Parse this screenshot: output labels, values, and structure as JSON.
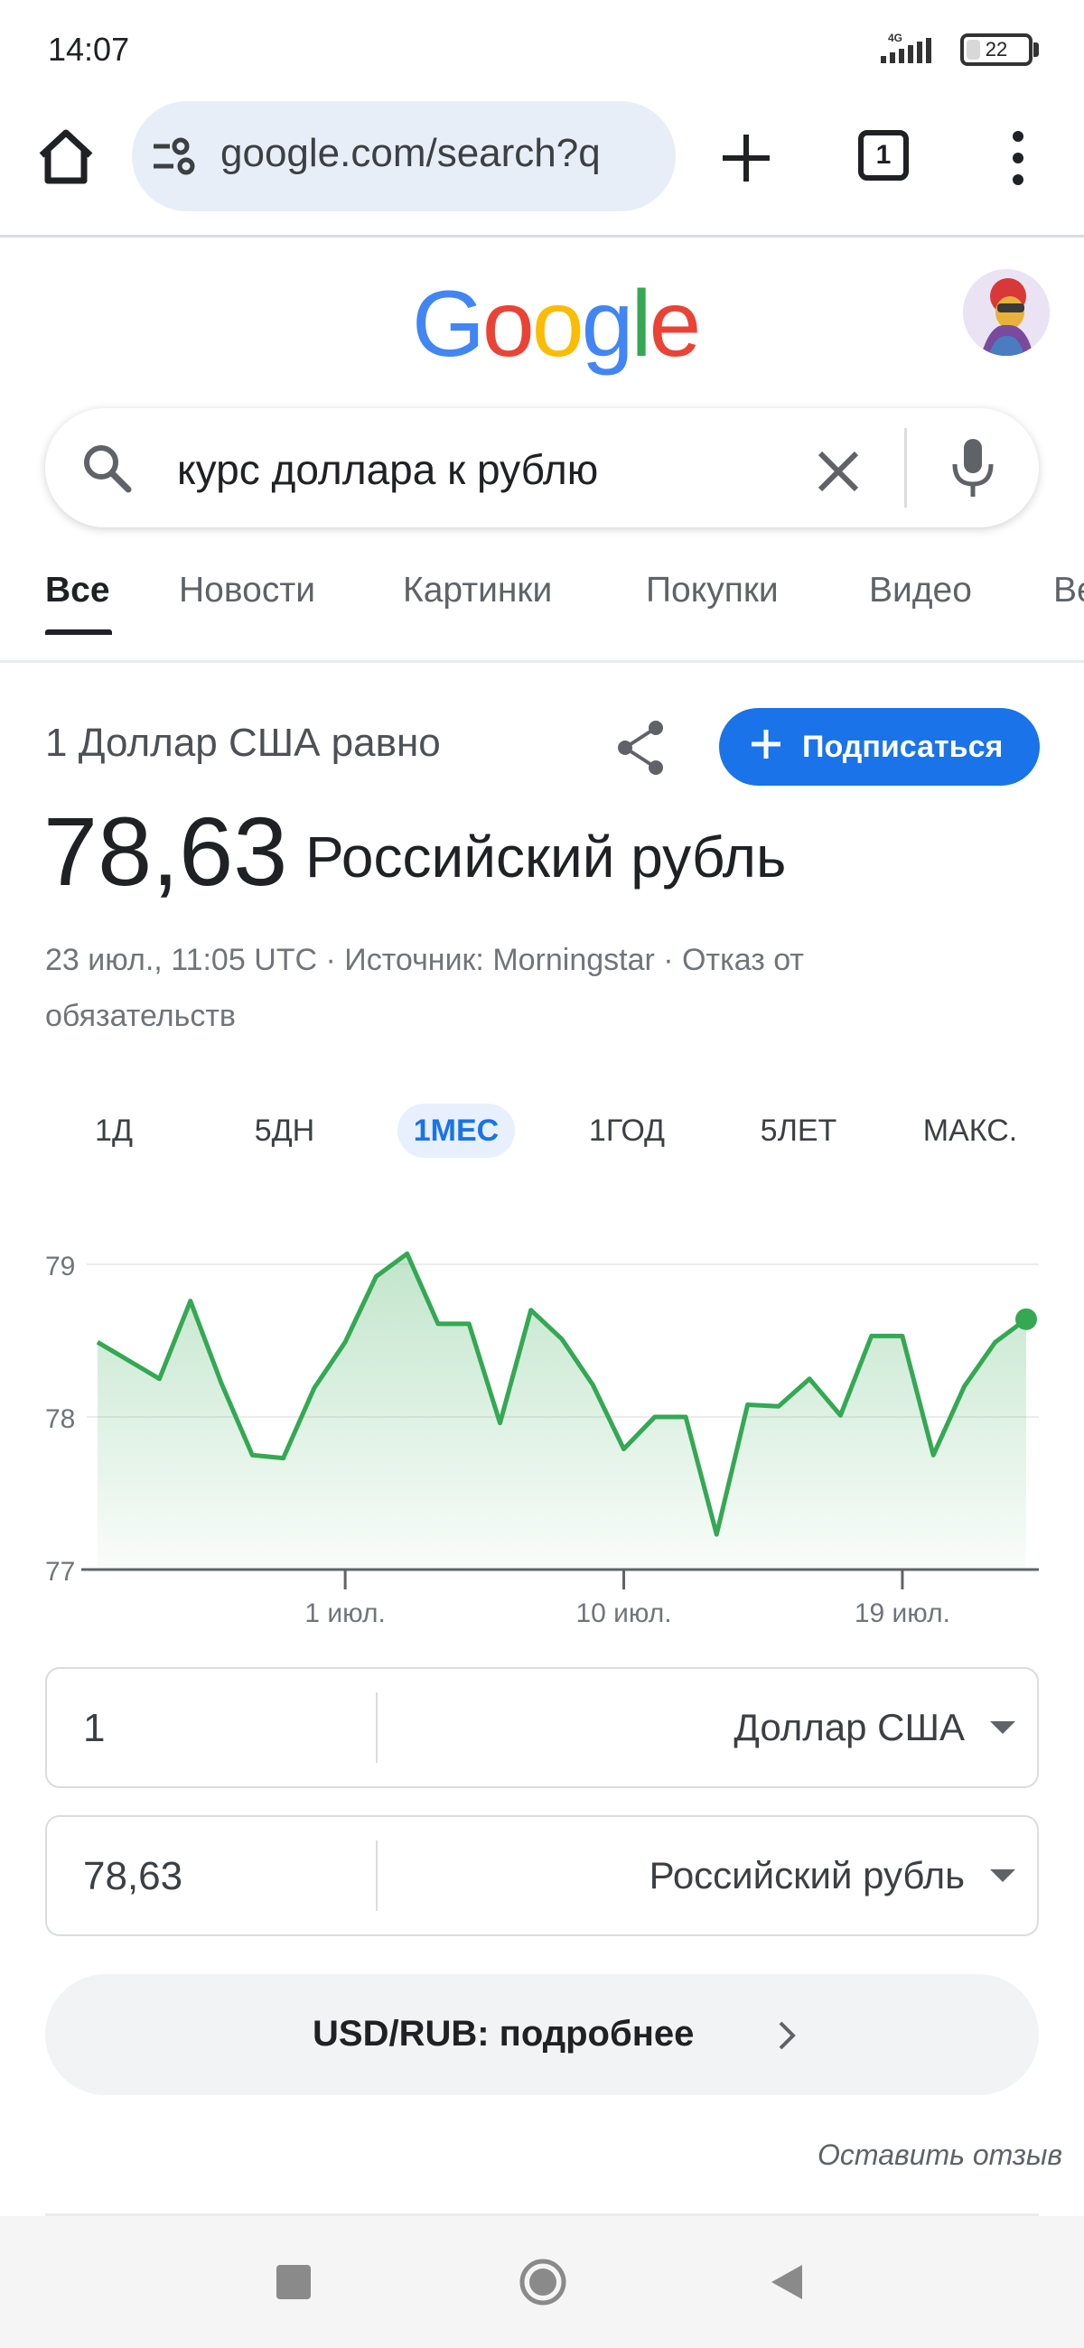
{
  "status_bar": {
    "time": "14:07",
    "network": "4G",
    "battery": "22",
    "battery_level": 0.22
  },
  "browser": {
    "url": "google.com/search?q",
    "tab_count": "1"
  },
  "search": {
    "query": "курс доллара к рублю"
  },
  "tabs": [
    {
      "label": "Все",
      "active": true
    },
    {
      "label": "Новости"
    },
    {
      "label": "Картинки"
    },
    {
      "label": "Покупки"
    },
    {
      "label": "Видео"
    },
    {
      "label": "Ве"
    }
  ],
  "result": {
    "equals_text": "1 Доллар США равно",
    "subscribe_label": "Подписаться",
    "rate_value": "78,63",
    "rate_currency": "Российский рубль",
    "meta_text": "23 июл., 11:05 UTC · Источник: Morningstar · Отказ от обязательств"
  },
  "ranges": [
    {
      "label": "1Д"
    },
    {
      "label": "5ДН"
    },
    {
      "label": "1МЕС",
      "active": true
    },
    {
      "label": "1ГОД"
    },
    {
      "label": "5ЛЕТ"
    },
    {
      "label": "МАКС."
    }
  ],
  "chart_data": {
    "type": "area",
    "ylim": [
      77,
      79
    ],
    "y_ticks": [
      "79",
      "78",
      "77"
    ],
    "x_ticks": [
      "1 июл.",
      "10 июл.",
      "19 июл."
    ],
    "x_tick_days": [
      1,
      10,
      19
    ],
    "x": [
      23.5,
      24.5,
      25.5,
      26.5,
      27.5,
      28.5,
      29.5,
      30.5,
      31.5,
      32.5,
      33.5,
      34.5,
      35.5,
      36.5,
      37.5,
      38.5,
      39.5,
      40.5,
      41.5,
      42.5,
      43.5,
      44.5,
      45.5,
      46.5,
      47.5,
      48.5,
      49.5,
      50.5,
      51.5,
      52.5,
      53.5
    ],
    "x_offset_note": "",
    "values": [
      78.49,
      78.37,
      78.25,
      78.76,
      78.22,
      77.75,
      77.73,
      78.19,
      78.49,
      78.92,
      79.07,
      78.61,
      78.61,
      77.96,
      78.7,
      78.51,
      78.21,
      77.79,
      78.0,
      78.0,
      77.23,
      78.08,
      78.07,
      78.25,
      78.01,
      78.53,
      78.53,
      77.75,
      78.2,
      78.49,
      78.64
    ],
    "line_color": "#34a853",
    "fill_color": "#34a853",
    "grid": true
  },
  "converter": {
    "from_amount": "1",
    "from_currency": "Доллар США",
    "to_amount": "78,63",
    "to_currency": "Российский рубль"
  },
  "details_label": "USD/RUB: подробнее",
  "feedback_label": "Оставить отзыв"
}
